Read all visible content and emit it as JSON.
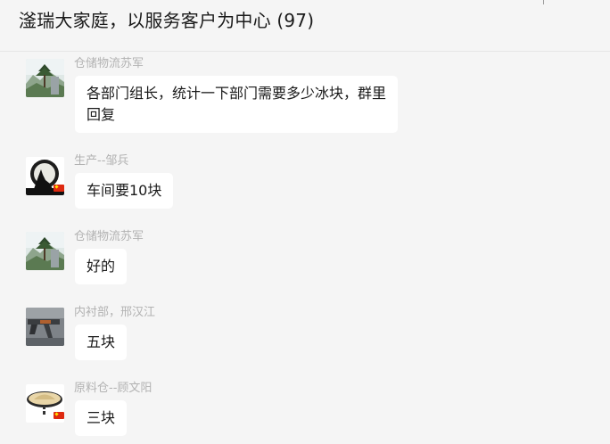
{
  "header": {
    "title": "滏瑞大家庭，以服务客户为中心 (97)"
  },
  "messages": [
    {
      "sender": "仓储物流苏军",
      "avatar": "landscape-pine-avatar",
      "lines": [
        "各部门组长，统计一下部门需要多少冰块，群里",
        "回复"
      ]
    },
    {
      "sender": "生产--邹兵",
      "avatar": "wolf-moon-avatar",
      "lines": [
        "车间要10块"
      ]
    },
    {
      "sender": "仓储物流苏军",
      "avatar": "landscape-pine-avatar",
      "lines": [
        "好的"
      ]
    },
    {
      "sender": "内衬部，邢汉江",
      "avatar": "rifle-avatar",
      "lines": [
        "五块"
      ]
    },
    {
      "sender": "原料仓--顾文阳",
      "avatar": "hat-avatar",
      "lines": [
        "三块"
      ]
    }
  ],
  "colors": {
    "background": "#f5f5f5",
    "bubble": "#ffffff",
    "sender_text": "#b2b2b2",
    "flag_red": "#de2910"
  }
}
